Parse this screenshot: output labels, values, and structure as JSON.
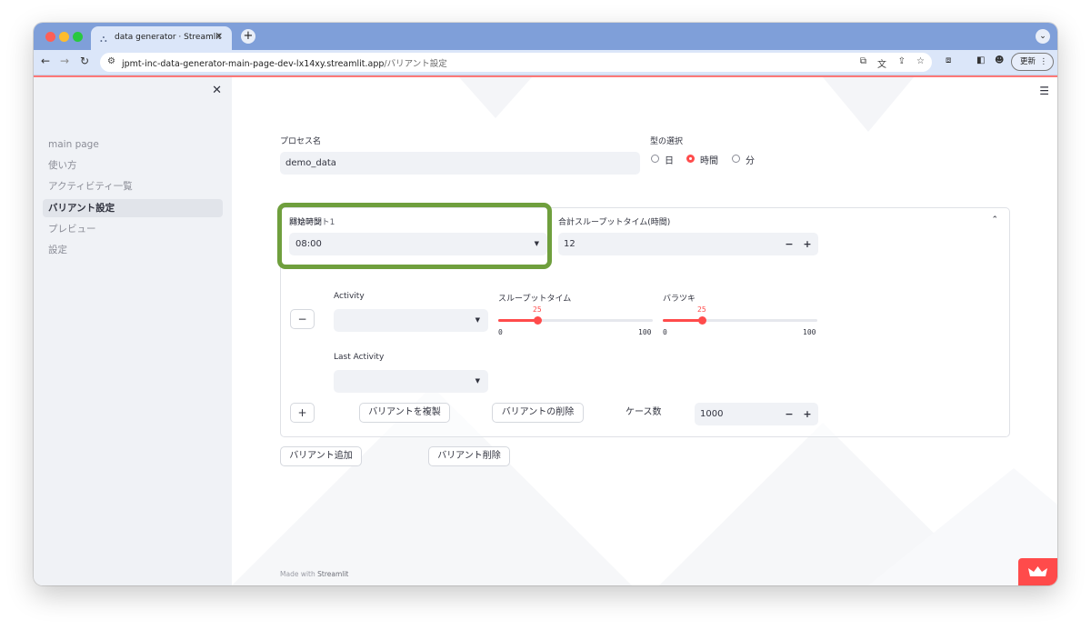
{
  "browser": {
    "tab_title": "data generator · Streamlit",
    "url_host": "jpmt-inc-data-generator-main-page-dev-lx14xy.streamlit.app",
    "url_path": "/バリアント設定",
    "update_label": "更新"
  },
  "sidebar": {
    "items": [
      {
        "label": "main page"
      },
      {
        "label": "使い方"
      },
      {
        "label": "アクティビティ一覧"
      },
      {
        "label": "バリアント設定"
      },
      {
        "label": "プレビュー"
      },
      {
        "label": "設定"
      }
    ]
  },
  "form": {
    "process_label": "プロセス名",
    "process_value": "demo_data",
    "type_label": "型の選択",
    "type_options": [
      "日",
      "時間",
      "分"
    ],
    "type_selected": "時間"
  },
  "variant": {
    "title": "バリアント1",
    "start_time_label": "開始時間",
    "start_time_value": "08:00",
    "throughput_label": "合計スループットタイム(時間)",
    "throughput_value": "12",
    "activity_label": "Activity",
    "slider1_label": "スループットタイム",
    "slider1_value": 25,
    "slider1_min": "0",
    "slider1_max": "100",
    "slider2_label": "バラツキ",
    "slider2_value": 25,
    "slider2_min": "0",
    "slider2_max": "100",
    "last_activity_label": "Last Activity",
    "minus_label": "−",
    "plus_label": "+",
    "duplicate_label": "バリアントを複製",
    "delete_label": "バリアントの削除",
    "cases_label": "ケース数",
    "cases_value": "1000"
  },
  "actions": {
    "add_label": "バリアント追加",
    "remove_label": "バリアント削除"
  },
  "footer": {
    "prefix": "Made with ",
    "brand": "Streamlit"
  },
  "colors": {
    "accent": "#ff4b4b",
    "highlight": "#6f9f3d",
    "sidebar_bg": "#f0f2f6"
  }
}
